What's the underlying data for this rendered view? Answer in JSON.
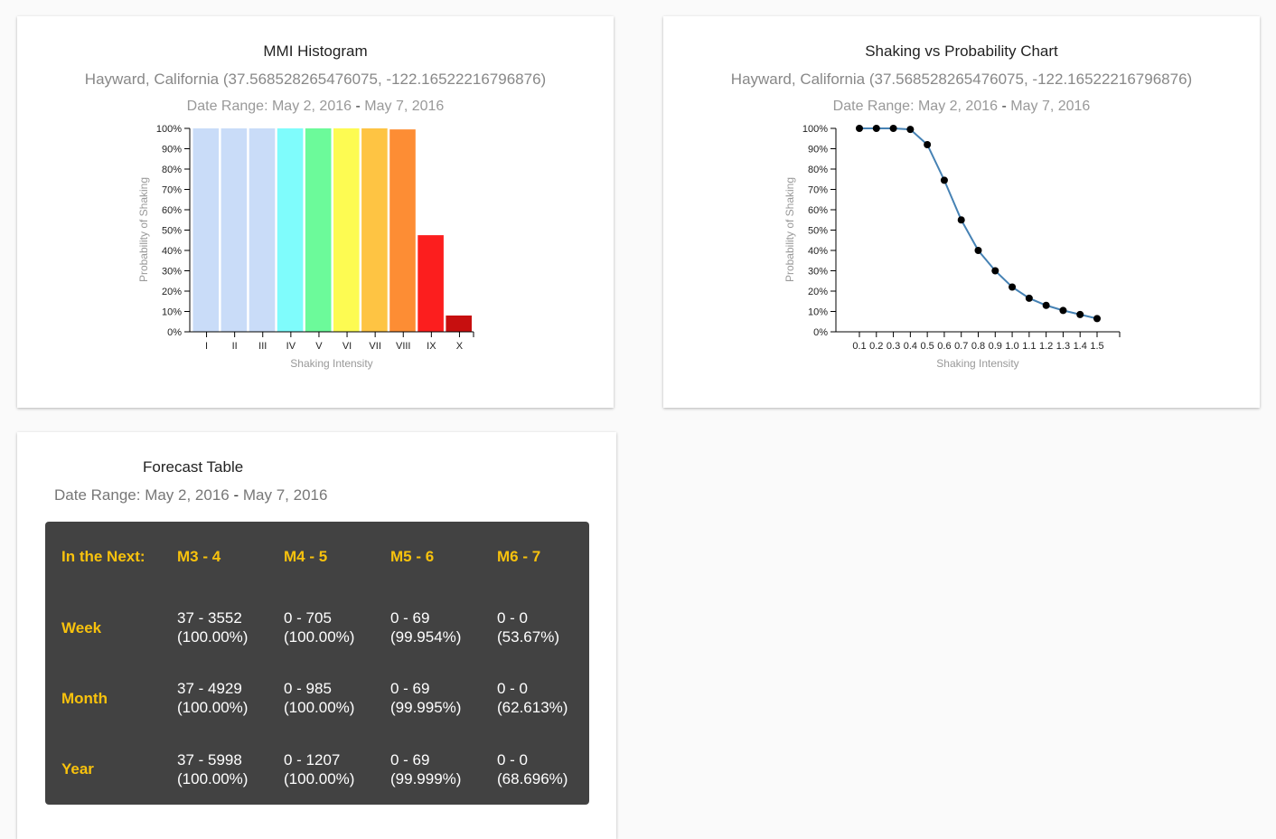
{
  "mmi_card": {
    "title": "MMI Histogram",
    "location": "Hayward, California (37.568528265476075, -122.16522216796876)",
    "date_range_label": "Date Range:",
    "start_date": "May 2, 2016",
    "end_date": "May 7, 2016"
  },
  "shaking_card": {
    "title": "Shaking vs Probability Chart",
    "location": "Hayward, California (37.568528265476075, -122.16522216796876)",
    "date_range_label": "Date Range:",
    "start_date": "May 2, 2016",
    "end_date": "May 7, 2016"
  },
  "forecast_card": {
    "title": "Forecast Table",
    "date_range_label": "Date Range:",
    "start_date": "May 2, 2016",
    "end_date": "May 7, 2016",
    "header": [
      "In the Next:",
      "M3 - 4",
      "M4 - 5",
      "M5 - 6",
      "M6 - 7"
    ],
    "rows": [
      {
        "period": "Week",
        "cells": [
          [
            "37 - 3552",
            "(100.00%)"
          ],
          [
            "0 - 705",
            "(100.00%)"
          ],
          [
            "0 - 69",
            "(99.954%)"
          ],
          [
            "0 - 0",
            "(53.67%)"
          ]
        ]
      },
      {
        "period": "Month",
        "cells": [
          [
            "37 - 4929",
            "(100.00%)"
          ],
          [
            "0 - 985",
            "(100.00%)"
          ],
          [
            "0 - 69",
            "(99.995%)"
          ],
          [
            "0 - 0",
            "(62.613%)"
          ]
        ]
      },
      {
        "period": "Year",
        "cells": [
          [
            "37 - 5998",
            "(100.00%)"
          ],
          [
            "0 - 1207",
            "(100.00%)"
          ],
          [
            "0 - 69",
            "(99.999%)"
          ],
          [
            "0 - 0",
            "(68.696%)"
          ]
        ]
      }
    ]
  },
  "chart_data": [
    {
      "type": "bar",
      "categories": [
        "I",
        "II",
        "III",
        "IV",
        "V",
        "VI",
        "VII",
        "VIII",
        "IX",
        "X"
      ],
      "values": [
        100,
        100,
        100,
        100,
        100,
        100,
        100,
        99.5,
        47.5,
        8
      ],
      "colors": [
        "#c9dcf8",
        "#c9dcf8",
        "#c9dcf8",
        "#7ffcfc",
        "#6cfa9a",
        "#fdfb52",
        "#fec443",
        "#fd8d34",
        "#fc1e1e",
        "#c70f0f"
      ],
      "xlabel": "Shaking Intensity",
      "ylabel": "Probability of Shaking",
      "ylim": [
        0,
        100
      ],
      "yticks": [
        "0%",
        "10%",
        "20%",
        "30%",
        "40%",
        "50%",
        "60%",
        "70%",
        "80%",
        "90%",
        "100%"
      ]
    },
    {
      "type": "line",
      "x": [
        0.1,
        0.2,
        0.3,
        0.4,
        0.5,
        0.6,
        0.7,
        0.8,
        0.9,
        1.0,
        1.1,
        1.2,
        1.3,
        1.4,
        1.5
      ],
      "x_tick_labels": [
        "0.1",
        "0.2",
        "0.3",
        "0.4",
        "0.5",
        "0.6",
        "0.7",
        "0.8",
        "0.9",
        "1.0",
        "1.1",
        "1.2",
        "1.3",
        "1.4",
        "1.5"
      ],
      "series": [
        {
          "values": [
            100,
            100,
            100,
            99.5,
            92,
            74.5,
            55,
            40,
            30,
            22,
            16.5,
            13,
            10.5,
            8.5,
            6.5
          ]
        }
      ],
      "line_color": "#4682b4",
      "marker_color": "#000000",
      "xlabel": "Shaking Intensity",
      "ylabel": "Probability of Shaking",
      "xlim": [
        0,
        1.5
      ],
      "ylim": [
        0,
        100
      ],
      "yticks": [
        "0%",
        "10%",
        "20%",
        "30%",
        "40%",
        "50%",
        "60%",
        "70%",
        "80%",
        "90%",
        "100%"
      ]
    }
  ]
}
